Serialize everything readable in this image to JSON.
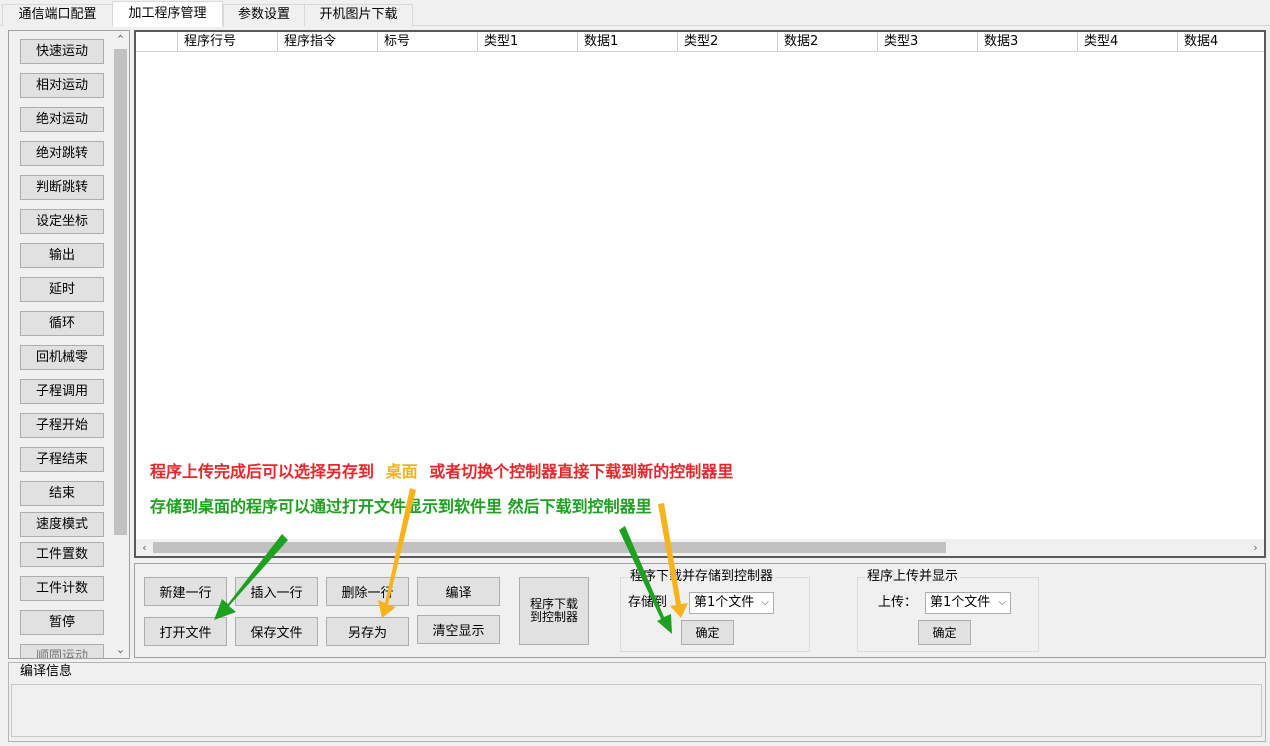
{
  "tabs": [
    {
      "label": "通信端口配置"
    },
    {
      "label": "加工程序管理"
    },
    {
      "label": "参数设置"
    },
    {
      "label": "开机图片下载"
    }
  ],
  "commands": [
    "快速运动",
    "相对运动",
    "绝对运动",
    "绝对跳转",
    "判断跳转",
    "设定坐标",
    "输出",
    "延时",
    "循环",
    "回机械零",
    "子程调用",
    "子程开始",
    "子程结束",
    "结束",
    "速度模式",
    "工件置数",
    "工件计数",
    "暂停",
    "顺圆运动"
  ],
  "grid": {
    "columns": [
      "程序行号",
      "程序指令",
      "标号",
      "类型1",
      "数据1",
      "类型2",
      "数据2",
      "类型3",
      "数据3",
      "类型4",
      "数据4"
    ]
  },
  "annotations": {
    "line1_a": "程序上传完成后可以选择另存到",
    "line1_b": "桌面",
    "line1_c": "或者切换个控制器直接下载到新的控制器里",
    "line2": "存储到桌面的程序可以通过打开文件显示到软件里   然后下载到控制器里",
    "colors": {
      "red": "#e8262b",
      "orange": "#f6b31b",
      "green": "#1ea020"
    }
  },
  "actions": {
    "new_row": "新建一行",
    "insert_row": "插入一行",
    "delete_row": "删除一行",
    "compile": "编译",
    "open_file": "打开文件",
    "save_file": "保存文件",
    "save_as": "另存为",
    "clear_display": "清空显示",
    "download_line1": "程序下载",
    "download_line2": "到控制器"
  },
  "download_group": {
    "title": "程序下载并存储到控制器",
    "store_label": "存储到",
    "selected": "第1个文件",
    "confirm": "确定"
  },
  "upload_group": {
    "title": "程序上传并显示",
    "upload_label": "上传：",
    "selected": "第1个文件",
    "confirm": "确定"
  },
  "compile_info": {
    "title": "编译信息"
  }
}
